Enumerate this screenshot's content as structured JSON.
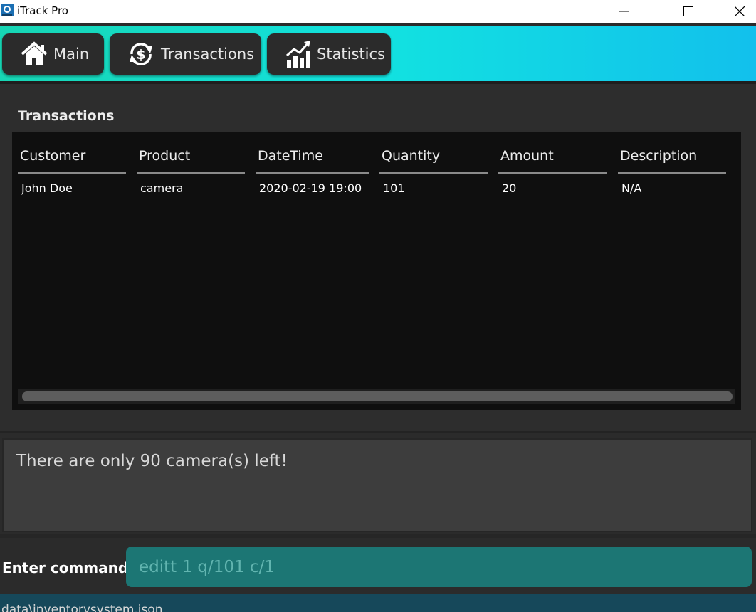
{
  "window": {
    "title": "iTrack Pro"
  },
  "nav": {
    "main_label": "Main",
    "transactions_label": "Transactions",
    "statistics_label": "Statistics"
  },
  "panel": {
    "title": "Transactions"
  },
  "table": {
    "headers": [
      "Customer",
      "Product",
      "DateTime",
      "Quantity",
      "Amount",
      "Description"
    ],
    "rows": [
      [
        "John Doe",
        "camera",
        "2020-02-19 19:00",
        "101",
        "20",
        "N/A"
      ]
    ]
  },
  "result": {
    "message": "There are only 90 camera(s) left!"
  },
  "command": {
    "label": "Enter command",
    "value": "editt 1 q/101 c/1"
  },
  "status": {
    "path": "data\\inventorysystem.json"
  },
  "colors": {
    "nav_gradient_start": "#17d6b4",
    "nav_gradient_end": "#12c0ec",
    "command_bg": "#1c7674",
    "status_bg": "#16485a"
  }
}
